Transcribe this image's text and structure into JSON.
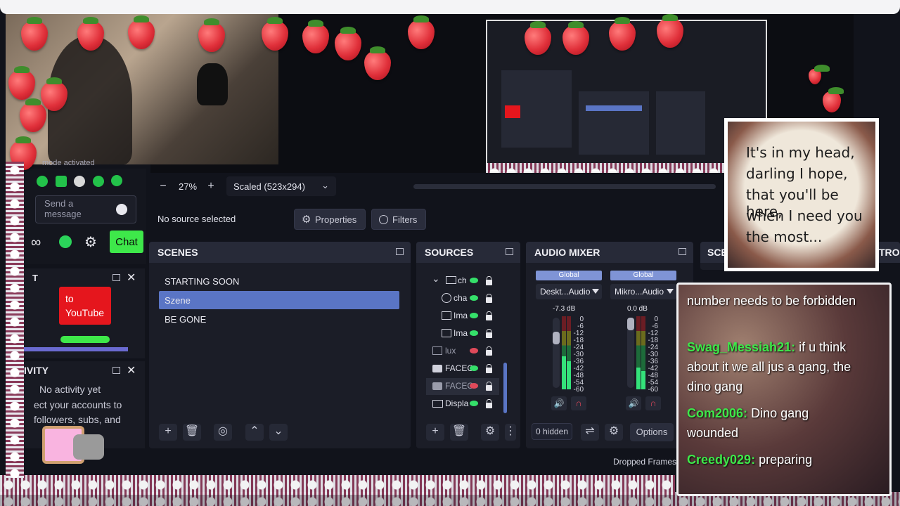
{
  "webcam_overlay": {
    "text": "mode activated"
  },
  "chat_dock": {
    "placeholder": "Send a message",
    "chat_button": "Chat",
    "alert_panel_title": "T",
    "youtube_button": "to YouTube"
  },
  "activity_dock": {
    "title": "IVITY",
    "empty": "No activity yet",
    "hint1": "ect your accounts to",
    "hint2": "followers, subs, and"
  },
  "preview_toolbar": {
    "zoom": "27%",
    "minus": "−",
    "plus": "+",
    "scale": "Scaled (523x294)"
  },
  "context_bar": {
    "status": "No source selected",
    "properties": "Properties",
    "filters": "Filters"
  },
  "scenes": {
    "title": "SCENES",
    "items": [
      "STARTING SOON",
      "Szene",
      "BE GONE"
    ],
    "selected_index": 1
  },
  "sources": {
    "title": "SOURCES",
    "items": [
      {
        "label": "ch",
        "visible": true
      },
      {
        "label": "cha",
        "visible": true
      },
      {
        "label": "Ima",
        "visible": true
      },
      {
        "label": "Ima",
        "visible": true
      },
      {
        "label": "lux",
        "visible": false
      },
      {
        "label": "FACEC",
        "visible": true
      },
      {
        "label": "FACEC",
        "visible": false
      },
      {
        "label": "Displa",
        "visible": true
      }
    ]
  },
  "audio_mixer": {
    "title": "AUDIO MIXER",
    "channels": [
      {
        "badge": "Global",
        "device": "Deskt...Audio",
        "db": "-7.3 dB",
        "level": 0.45
      },
      {
        "badge": "Global",
        "device": "Mikro...Audio",
        "db": "0.0 dB",
        "level": 0.3
      }
    ],
    "scale": [
      "0",
      "-6",
      "-12",
      "-18",
      "-24",
      "-30",
      "-36",
      "-42",
      "-48",
      "-54",
      "-60"
    ],
    "hidden": "0 hidden",
    "options": "Options"
  },
  "cut_panels": {
    "scene_transitions": "SCE",
    "controls": "TRO"
  },
  "status_bar": {
    "dropped": "Dropped Frames"
  },
  "lyric_card": {
    "lines": [
      "It's in my head,",
      "darling I hope,",
      "that you'll be here,",
      "when I need you",
      "the most..."
    ]
  },
  "chat_overlay": {
    "messages": [
      {
        "name": "",
        "text": "number needs to be forbidden"
      },
      {
        "name": "Swag_Messiah21:",
        "text": "if u think about it we all jus a gang, the dino gang"
      },
      {
        "name": "Com2006:",
        "text": "Dino gang wounded"
      },
      {
        "name": "Creedy029:",
        "text": "preparing"
      }
    ]
  },
  "colors": {
    "accent": "#5a75c5",
    "panel": "#1b1d27",
    "chat_green": "#3ee84a",
    "youtube": "#e5161d"
  }
}
